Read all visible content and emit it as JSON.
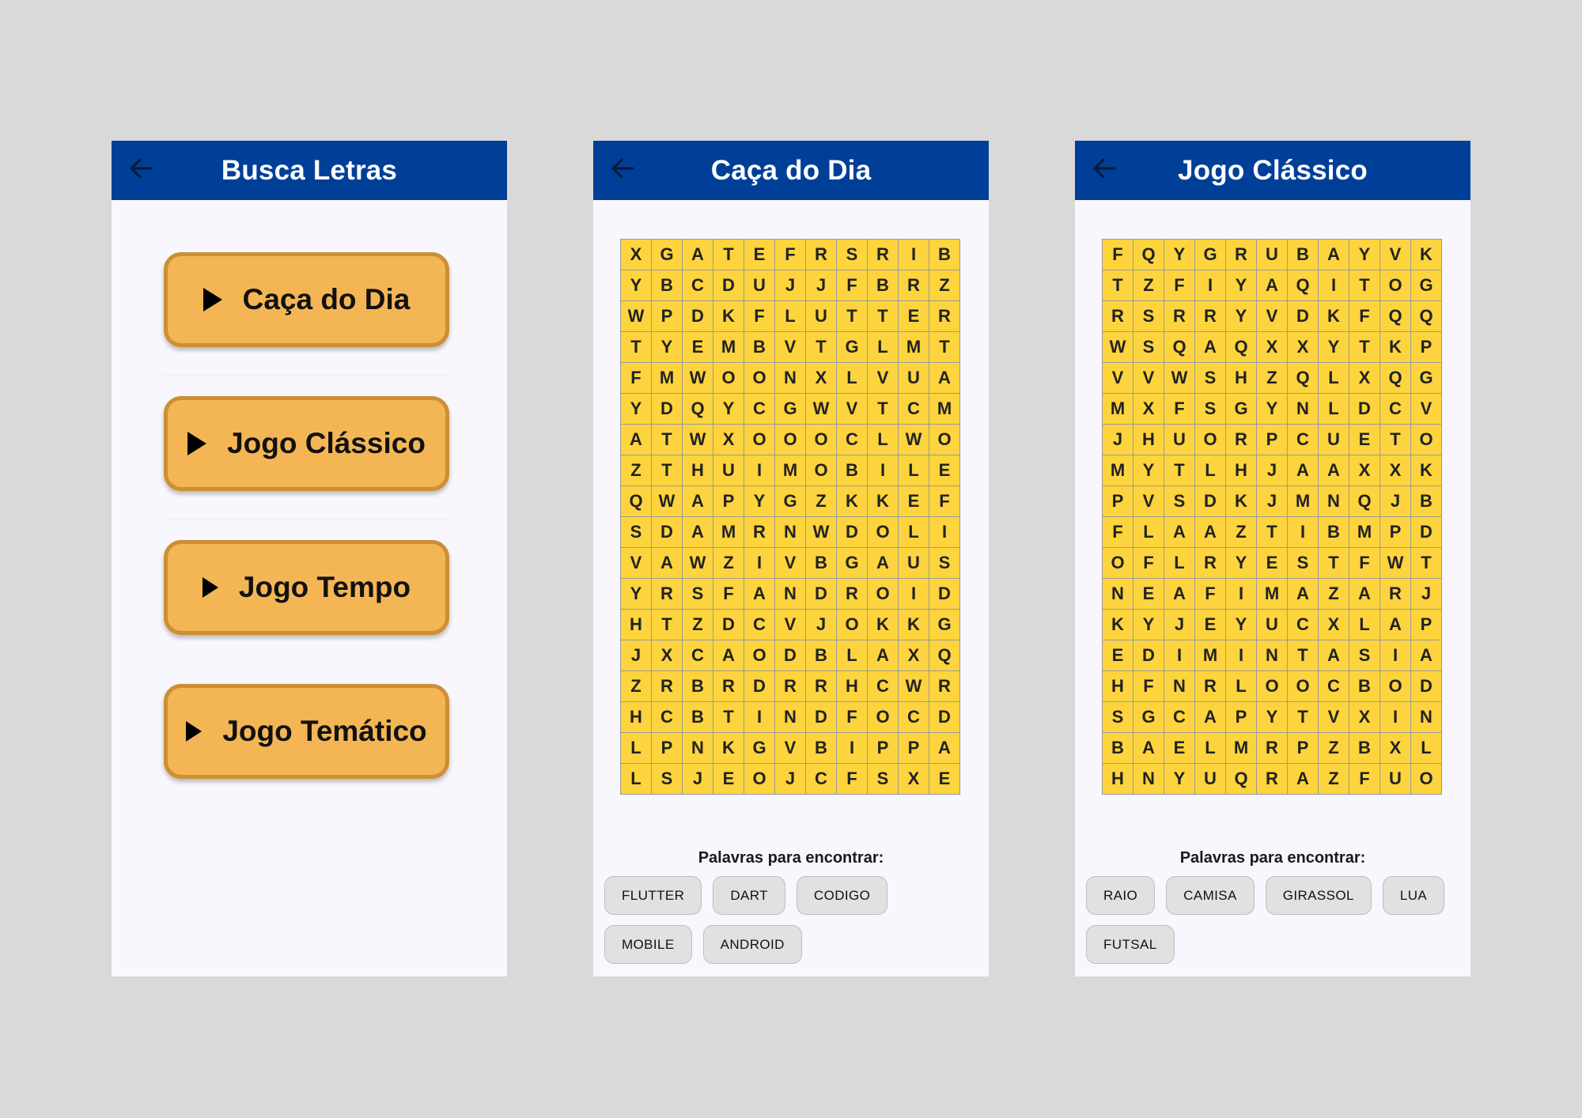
{
  "colors": {
    "appbar": "#003f98",
    "button": "#f4b654",
    "button_border": "#cc8f34",
    "cell": "#fdd43d"
  },
  "menu": {
    "title": "Busca Letras",
    "buttons": [
      "Caça do Dia",
      "Jogo Clássico",
      "Jogo Tempo",
      "Jogo Temático"
    ]
  },
  "daily": {
    "title": "Caça do Dia",
    "grid": [
      "XGATEFRSRIB",
      "YBCDUJJFBRZ",
      "WPDKFLUTTER",
      "TYEMBVTGLMT",
      "FMWOONXLVUA",
      "YDQYCGWVTCM",
      "ATWXOOOCLWO",
      "ZTHUIMOBILE",
      "QWAPYGZKKEF",
      "SDAMRNWDOLI",
      "VAWZIVBGAUS",
      "YRSFANDROID",
      "HTZDCVJOKKG",
      "JXCAODBLAXQ",
      "ZRBRDRRHCWR",
      "HCBTINDFOCD",
      "LPNKGVBIPPA",
      "LSJEOJCFSXE"
    ],
    "words_title": "Palavras para encontrar:",
    "words": [
      "FLUTTER",
      "DART",
      "CODIGO",
      "MOBILE",
      "ANDROID"
    ]
  },
  "classic": {
    "title": "Jogo Clássico",
    "grid": [
      "FQYGRUBAYVK",
      "TZFIYAQITOG",
      "RSRRYVDKFQQ",
      "WSQAQXXYTKP",
      "VVWSHZQLXQG",
      "MXFSGYNLDCV",
      "JHUORPCUETO",
      "MYTLHJAAXXK",
      "PVSDKJMNQJB",
      "FLAAZTIBMPD",
      "OFLRYESTFWT",
      "NEAFIMAZARJ",
      "KYJEYUCXLAP",
      "EDIMINTASIA",
      "HFNRLOOCBOD",
      "SGCAPYTVXIN",
      "BAELMRPZBXL",
      "HNYUQRAZFUO"
    ],
    "words_title": "Palavras para encontrar:",
    "words": [
      "RAIO",
      "CAMISA",
      "GIRASSOL",
      "LUA",
      "FUTSAL"
    ]
  }
}
